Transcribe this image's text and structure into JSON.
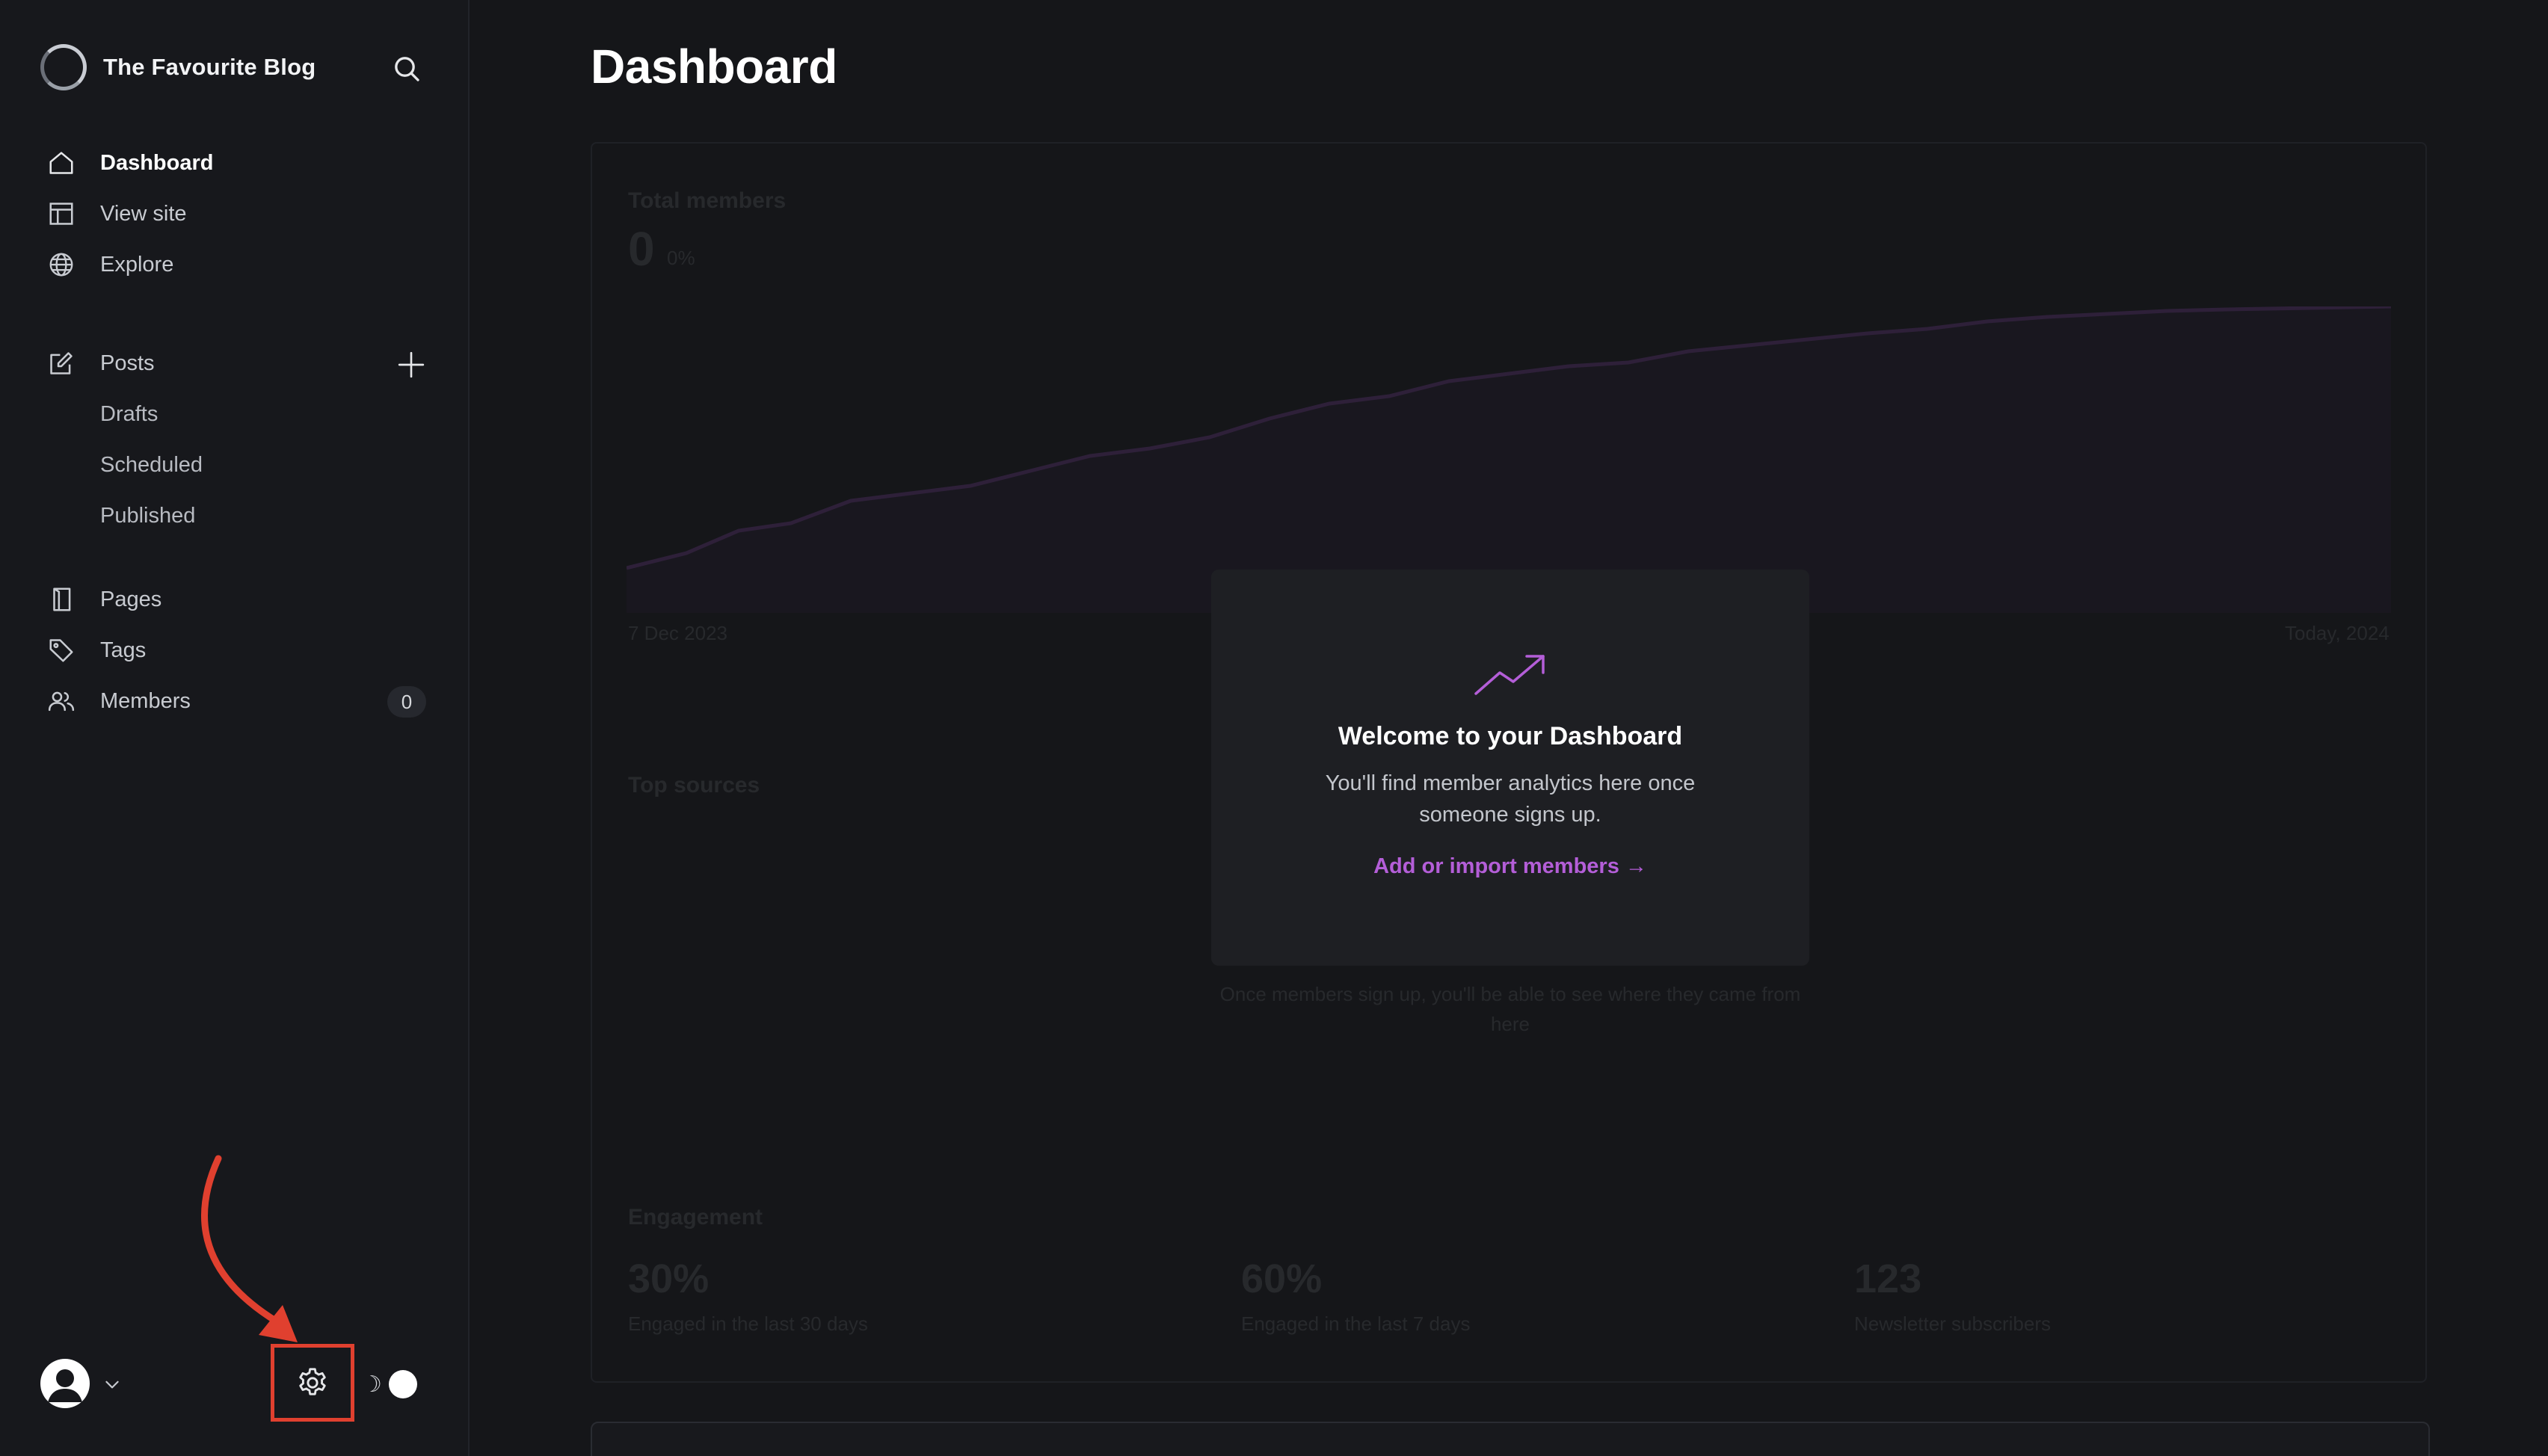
{
  "sidebar": {
    "brand": {
      "name": "The Favourite Blog"
    },
    "nav": {
      "dashboard": "Dashboard",
      "view_site": "View site",
      "explore": "Explore",
      "posts": "Posts",
      "drafts": "Drafts",
      "scheduled": "Scheduled",
      "published": "Published",
      "pages": "Pages",
      "tags": "Tags",
      "members": "Members",
      "members_count": "0"
    },
    "theme_toggle": {
      "moon_glyph": "☽"
    }
  },
  "main": {
    "title": "Dashboard",
    "background": {
      "total_members_label": "Total members",
      "total_members_value": "0",
      "total_members_unit": "0%",
      "chart_start": "7 Dec 2023",
      "chart_end": "Today, 2024",
      "top_sources_label": "Top sources",
      "top_sources_text": "Once members sign up, you'll be able to see where they came from here",
      "engagement_label": "Engagement",
      "engagement_1_value": "30%",
      "engagement_1_label": "Engaged in the last 30 days",
      "engagement_2_value": "60%",
      "engagement_2_label": "Engaged in the last 7 days",
      "engagement_3_value": "123",
      "engagement_3_label": "Newsletter subscribers"
    },
    "welcome": {
      "title": "Welcome to your Dashboard",
      "text": "You'll find member analytics here once someone signs up.",
      "link": "Add or import members →"
    }
  },
  "colors": {
    "accent": "#b45ed8",
    "annotation": "#e0402f",
    "background": "#151619",
    "sidebar": "#17181c"
  }
}
